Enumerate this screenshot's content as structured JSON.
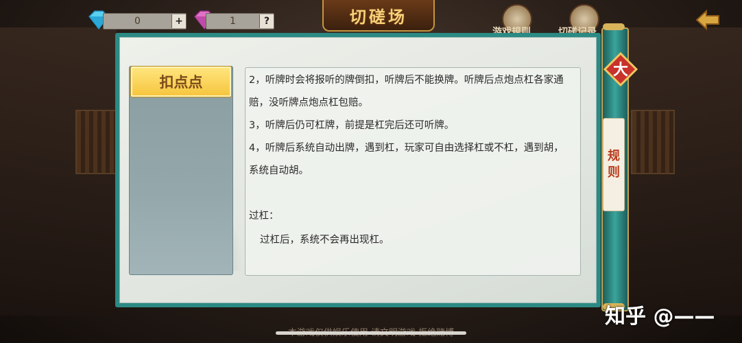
{
  "header": {
    "title": "切磋场",
    "diamond_count": "0",
    "diamond_button": "+",
    "gem_count": "1",
    "gem_button": "?",
    "menu_label": "游戏规则",
    "record_label": "切磋记录"
  },
  "sidebar": {
    "items": [
      {
        "label": "扣点点",
        "active": true
      }
    ]
  },
  "content": {
    "lines": [
      "2，听牌时会将报听的牌倒扣，听牌后不能换牌。听牌后点炮点杠各家通",
      "赔，没听牌点炮点杠包赔。",
      "3，听牌后仍可杠牌，前提是杠完后还可听牌。",
      "4，听牌后系统自动出牌，遇到杠，玩家可自由选择杠或不杠，遇到胡，",
      "系统自动胡。",
      "过杠：",
      "过杠后，系统不会再出现杠。"
    ]
  },
  "scroll": {
    "badge": "大",
    "tab_label_1": "规",
    "tab_label_2": "则"
  },
  "footer": {
    "notice": "本游戏仅供娱乐使用 请文明游戏 拒绝赌博"
  },
  "watermark": "知乎 @——",
  "colors": {
    "panel_border": "#2b8a84",
    "tab_active": "#f6c43c",
    "title_gold": "#f5d27a",
    "rule_red": "#b83a1a"
  }
}
